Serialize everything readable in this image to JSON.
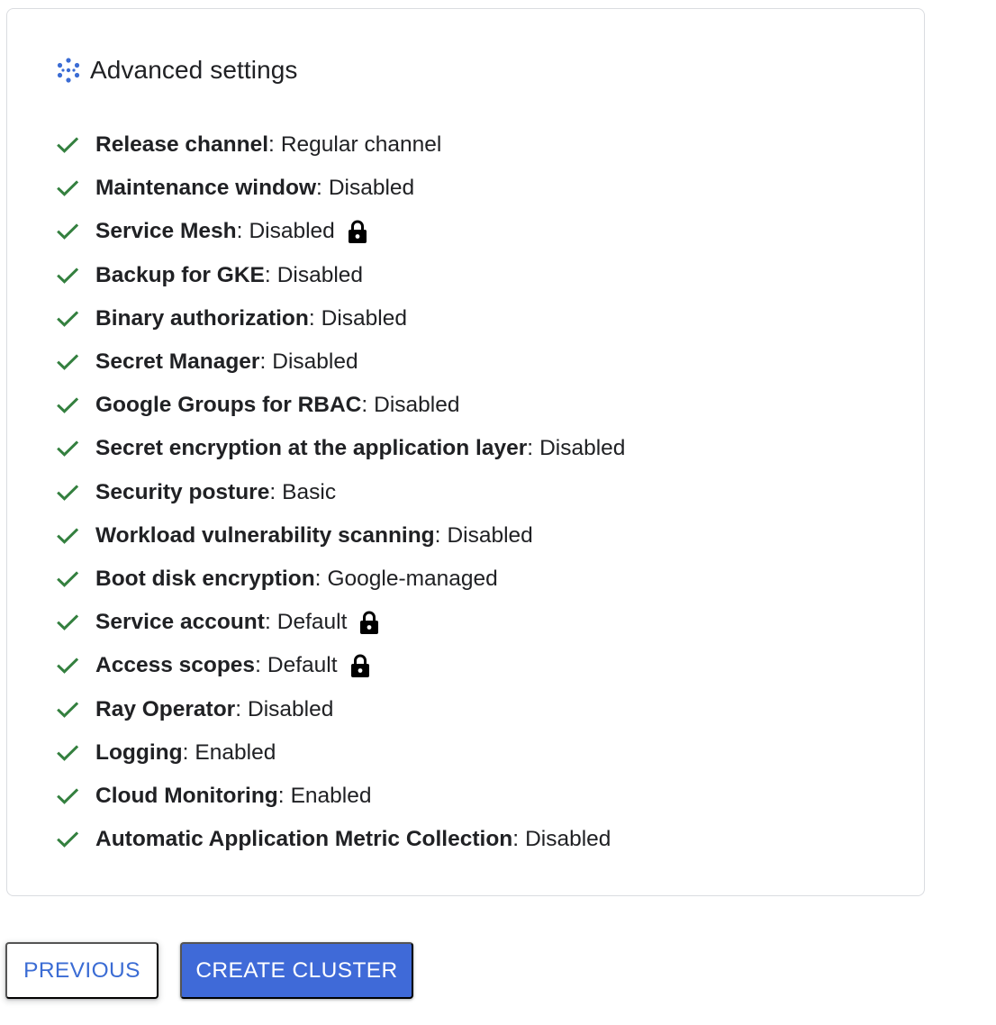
{
  "section": {
    "title": "Advanced settings",
    "icon": "dots-cluster-icon",
    "accent_color": "#3b6cd4",
    "check_color": "#34803f"
  },
  "settings": [
    {
      "key": "Release channel",
      "value": "Regular channel",
      "locked": false
    },
    {
      "key": "Maintenance window",
      "value": "Disabled",
      "locked": false
    },
    {
      "key": "Service Mesh",
      "value": "Disabled",
      "locked": true
    },
    {
      "key": "Backup for GKE",
      "value": "Disabled",
      "locked": false
    },
    {
      "key": "Binary authorization",
      "value": "Disabled",
      "locked": false
    },
    {
      "key": "Secret Manager",
      "value": "Disabled",
      "locked": false
    },
    {
      "key": "Google Groups for RBAC",
      "value": "Disabled",
      "locked": false
    },
    {
      "key": "Secret encryption at the application layer",
      "value": "Disabled",
      "locked": false
    },
    {
      "key": "Security posture",
      "value": "Basic",
      "locked": false
    },
    {
      "key": "Workload vulnerability scanning",
      "value": "Disabled",
      "locked": false
    },
    {
      "key": "Boot disk encryption",
      "value": "Google-managed",
      "locked": false
    },
    {
      "key": "Service account",
      "value": "Default",
      "locked": true
    },
    {
      "key": "Access scopes",
      "value": "Default",
      "locked": true
    },
    {
      "key": "Ray Operator",
      "value": "Disabled",
      "locked": false
    },
    {
      "key": "Logging",
      "value": "Enabled",
      "locked": false
    },
    {
      "key": "Cloud Monitoring",
      "value": "Enabled",
      "locked": false
    },
    {
      "key": "Automatic Application Metric Collection",
      "value": "Disabled",
      "locked": false
    }
  ],
  "buttons": {
    "previous_label": "PREVIOUS",
    "create_label": "CREATE CLUSTER",
    "create_color": "#3f6ad8"
  }
}
